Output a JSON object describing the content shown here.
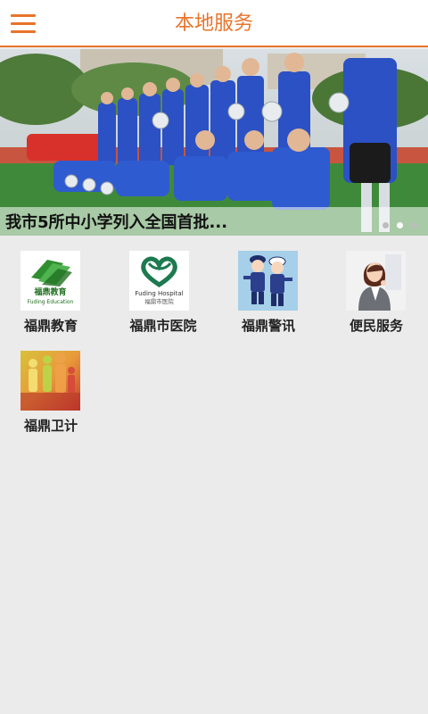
{
  "header": {
    "title": "本地服务",
    "menu_icon": "hamburger-menu-icon"
  },
  "banner": {
    "caption": "我市5所中小学列入全国首批...",
    "slide_count": 3,
    "active_slide": 2
  },
  "services": [
    {
      "label": "福鼎教育",
      "icon": "education-logo-icon",
      "logo_line1": "福鼎教育",
      "logo_line2": "Fuding Education"
    },
    {
      "label": "福鼎市医院",
      "icon": "hospital-logo-icon",
      "logo_line1": "Fuding Hospital",
      "logo_line2": "福鼎市医院"
    },
    {
      "label": "福鼎警讯",
      "icon": "police-icon"
    },
    {
      "label": "便民服务",
      "icon": "customer-service-icon"
    },
    {
      "label": "福鼎卫计",
      "icon": "health-family-planning-icon"
    }
  ],
  "colors": {
    "accent": "#e8742b",
    "background": "#ebebeb"
  }
}
